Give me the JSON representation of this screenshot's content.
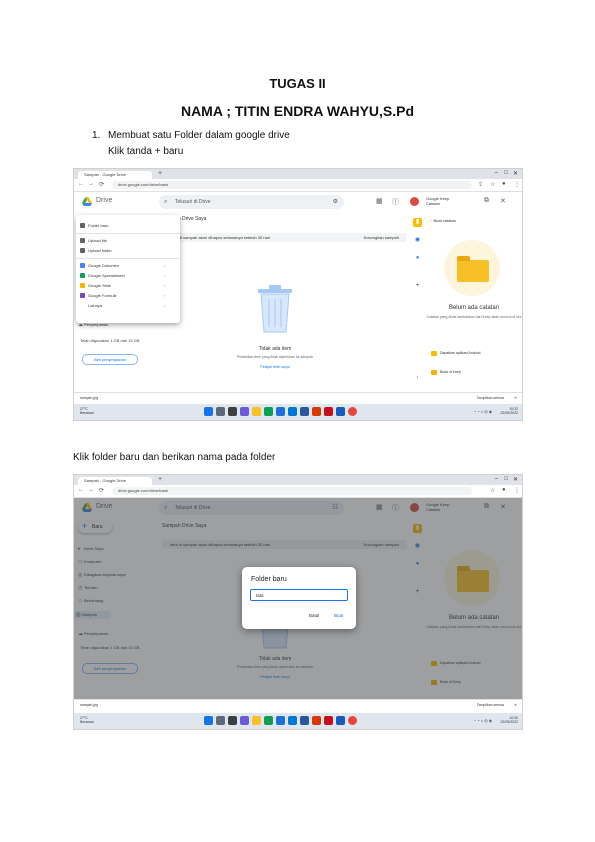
{
  "doc": {
    "title": "TUGAS II",
    "name_line": "NAMA ; TITIN ENDRA WAHYU,S.Pd",
    "step1_num": "1.",
    "step1": "Membuat satu Folder dalam google drive",
    "step1_sub": "Klik tanda + baru",
    "step2": "Klik folder baru dan berikan nama pada folder"
  },
  "browser": {
    "tab_title": "Sampah - Google Drive",
    "url": "drive.google.com/drive/trash",
    "new_tab": "+",
    "back_icon": "arrow-left-icon",
    "forward_icon": "arrow-right-icon",
    "reload_icon": "reload-icon"
  },
  "drive": {
    "app_name": "Drive",
    "search_placeholder": "Telusuri di Drive",
    "new_button": "Baru",
    "notes_header": "Google Keep",
    "notes_sub": "Catatan",
    "main_title": "Sampah Drive Saya",
    "banner_text": "Item di sampah akan dihapus selamanya setelah 30 hari",
    "banner_link": "Kosongkan sampah",
    "nav_items": [
      "Drive Saya",
      "Komputer",
      "Dibagikan kepada saya",
      "Terbaru",
      "Berbintang",
      "Sampah"
    ],
    "storage_label": "Penyimpanan",
    "storage_text": "Telah digunakan 1 GB dari 15 GB",
    "buy_storage": "Beli penyimpanan",
    "empty_title": "Tidak ada item",
    "empty_sub": "Pindahkan item yang tidak diperlukan ke sampah",
    "empty_link": "Pelajari lebih lanjut",
    "keep_add": "Buat catatan",
    "keep_empty_title": "Belum ada catatan",
    "keep_empty_sub": "Catatan yang Anda tambahkan dari Keep akan muncul di sini",
    "keep_items": [
      "Dapatkan aplikasi Android",
      "Buka di Keep"
    ]
  },
  "menu": {
    "items": [
      "Folder baru",
      "Upload file",
      "Upload folder",
      "Google Dokumen",
      "Google Spreadsheet",
      "Google Slide",
      "Google Formulir",
      "Lainnya"
    ]
  },
  "dialog": {
    "title": "Folder baru",
    "input_value": "tata",
    "cancel": "Batal",
    "create": "Buat"
  },
  "download_bar": {
    "file": "sampah.jpg",
    "show_all": "Tampilkan semua"
  },
  "taskbar": {
    "weather": "27°C",
    "weather_sub": "Berawan",
    "time": "10:32",
    "date": "22/09/2022"
  },
  "colors": {
    "google_blue": "#1a73e8",
    "folder_yellow": "#f6c026",
    "overlay": "#3c4043"
  }
}
